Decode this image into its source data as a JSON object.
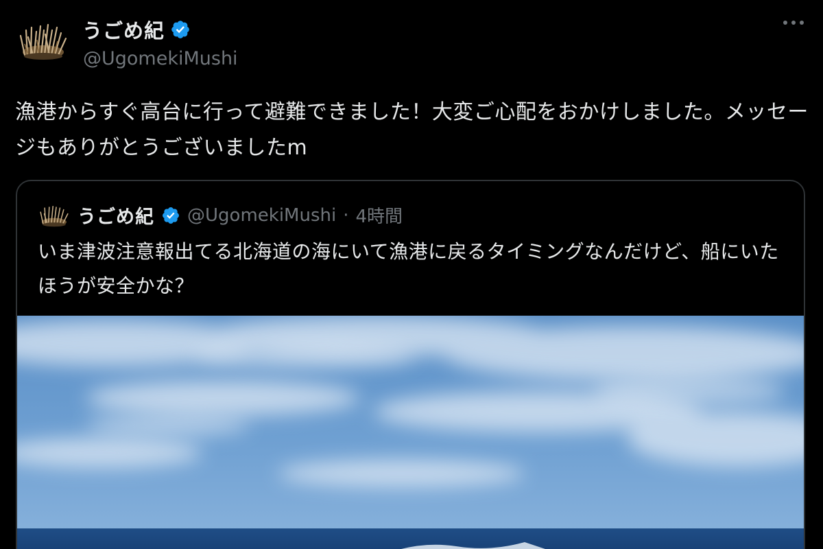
{
  "tweet": {
    "display_name": "うごめ紀",
    "handle": "@UgomekiMushi",
    "text": "漁港からすぐ高台に行って避難できました！大変ご心配をおかけしました。メッセージもありがとうございましたm"
  },
  "quote": {
    "display_name": "うごめ紀",
    "handle": "@UgomekiMushi",
    "separator": "·",
    "time": "4時間",
    "text": "いま津波注意報出てる北海道の海にいて漁港に戻るタイミングなんだけど、船にいたほうが安全かな？"
  },
  "icons": {
    "verified": "verified-badge-icon",
    "more": "more-options-icon",
    "avatar": "grass-bug-avatar"
  },
  "colors": {
    "background": "#000000",
    "text": "#e7e9ea",
    "muted": "#71767b",
    "verified": "#1d9bf0",
    "border": "#2f3336"
  }
}
